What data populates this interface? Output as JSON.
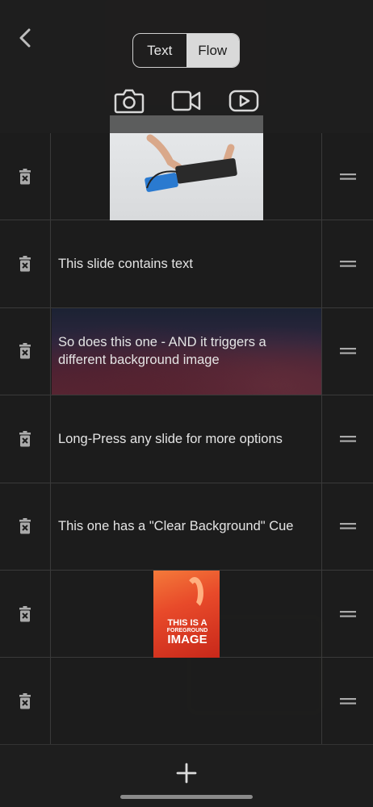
{
  "header": {
    "segments": [
      {
        "label": "Text",
        "active": false
      },
      {
        "label": "Flow",
        "active": true
      }
    ],
    "media_icons": [
      "camera-icon",
      "video-camera-icon",
      "youtube-play-icon"
    ]
  },
  "slides": [
    {
      "type": "video",
      "text": ""
    },
    {
      "type": "text",
      "text": "This slide contains text"
    },
    {
      "type": "text-background",
      "text": "So does this one - AND it triggers a different background image"
    },
    {
      "type": "text",
      "text": "Long-Press any slide for more options"
    },
    {
      "type": "text",
      "text": "This one has a \"Clear Background\" Cue"
    },
    {
      "type": "image",
      "text": "",
      "image_caption": {
        "line1": "THIS IS A",
        "line2": "FOREGROUND",
        "line3": "IMAGE"
      }
    },
    {
      "type": "empty",
      "text": ""
    }
  ],
  "icons": {
    "back": "chevron-left-icon",
    "delete": "trash-icon",
    "reorder": "drag-handle-icon",
    "add": "plus-icon"
  },
  "colors": {
    "background": "#1a1a1a",
    "segment_active": "#d9d9d9",
    "divider": "#3a3a3a"
  }
}
